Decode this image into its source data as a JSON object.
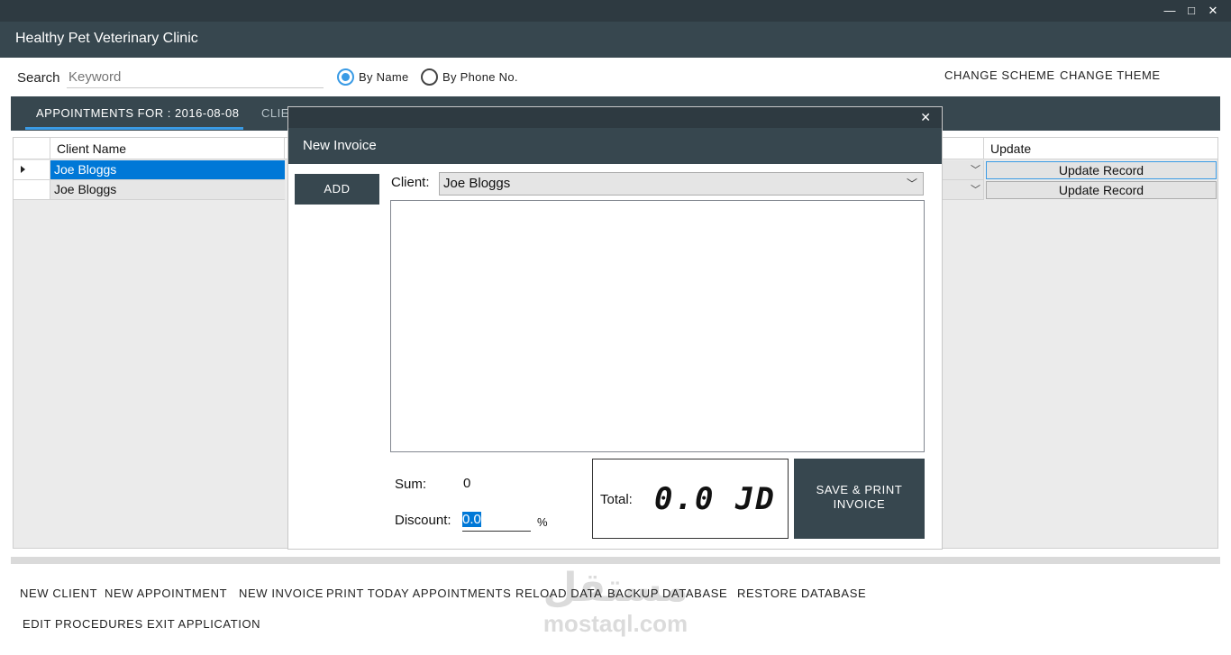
{
  "window": {
    "title": "Healthy Pet Veterinary Clinic",
    "minimize": "—",
    "maximize": "□",
    "close": "✕"
  },
  "search": {
    "label": "Search",
    "placeholder": "Keyword",
    "options": [
      {
        "label": "By Name",
        "selected": true
      },
      {
        "label": "By Phone No.",
        "selected": false
      }
    ]
  },
  "top_links": {
    "scheme": "CHANGE SCHEME",
    "theme": "CHANGE THEME"
  },
  "tabs": [
    {
      "label": "APPOINTMENTS FOR : 2016-08-08",
      "active": true
    },
    {
      "label": "CLIE",
      "active": false
    }
  ],
  "grid": {
    "columns": [
      "Client Name",
      "Update"
    ],
    "rows": [
      {
        "client": "Joe Bloggs",
        "update": "Update Record",
        "selected": true
      },
      {
        "client": "Joe Bloggs",
        "update": "Update Record",
        "selected": false
      }
    ]
  },
  "dialog": {
    "title": "New Invoice",
    "close": "✕",
    "add_label": "ADD",
    "client_label": "Client:",
    "client_value": "Joe Bloggs",
    "sum_label": "Sum:",
    "sum_value": "0",
    "discount_label": "Discount:",
    "discount_value": "0.0",
    "percent": "%",
    "total_label": "Total:",
    "total_value": "0.0 JD",
    "save_label": "SAVE & PRINT INVOICE"
  },
  "commands": [
    "NEW CLIENT",
    "NEW APPOINTMENT",
    "NEW INVOICE",
    "PRINT TODAY APPOINTMENTS",
    "RELOAD DATA",
    "BACKUP DATABASE",
    "RESTORE DATABASE",
    "EDIT PROCEDURES",
    "EXIT APPLICATION"
  ],
  "watermark": {
    "arabic": "مستقل",
    "latin": "mostaql.com"
  },
  "colors": {
    "header": "#37474f",
    "titlebar": "#2e3a41",
    "accent": "#3a9be5",
    "selection": "#0078d7"
  }
}
